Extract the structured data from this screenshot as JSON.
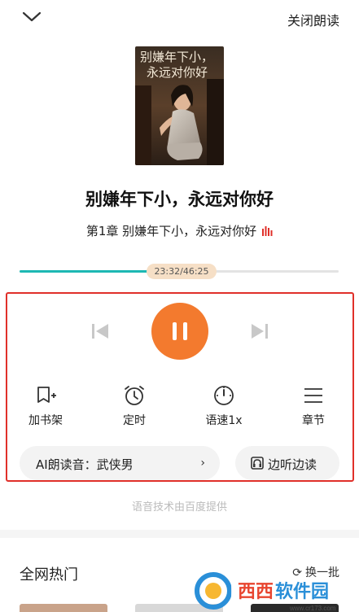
{
  "header": {
    "close_label": "关闭朗读",
    "collapse_icon": "chevron-down-icon"
  },
  "book": {
    "title": "别嫌年下小，永远对你好",
    "chapter": "第1章 别嫌年下小，永远对你好",
    "cover_text_line1": "别嫌年下小，",
    "cover_text_line2": "永远对你好"
  },
  "playback": {
    "current_time": "23:32",
    "total_time": "46:25",
    "time_label": "23:32/46:25",
    "progress": 0.507,
    "state": "playing"
  },
  "tools": [
    {
      "label": "加书架",
      "icon": "add-bookshelf-icon"
    },
    {
      "label": "定时",
      "icon": "alarm-clock-icon"
    },
    {
      "label": "语速1x",
      "icon": "speedometer-icon"
    },
    {
      "label": "章节",
      "icon": "menu-lines-icon"
    }
  ],
  "voice": {
    "label": "AI朗读音：武侠男",
    "chevron": "›"
  },
  "listen_read": {
    "label": "边听边读",
    "icon": "headphones-book-icon"
  },
  "provider_text": "语音技术由百度提供",
  "hot": {
    "title": "全网热门",
    "refresh_label": "换一批"
  },
  "watermark": {
    "brand": "西西软件园",
    "url": "www.cr173.com"
  },
  "colors": {
    "accent_orange": "#f37a2e",
    "progress_teal": "#1db8b3",
    "highlight_red": "#e0302a",
    "thumb_bg": "#f6dfc6"
  }
}
